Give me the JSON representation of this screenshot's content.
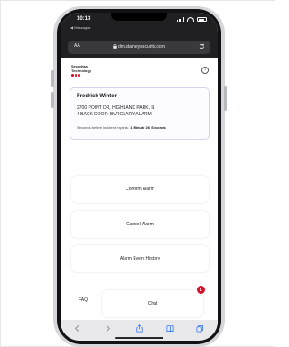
{
  "status_bar": {
    "time": "10:13",
    "back_app": "◀ Messages"
  },
  "browser": {
    "aa_label": "AA",
    "url": "dm.stanleysecurity.com"
  },
  "header": {
    "brand_line1": "Securitas",
    "brand_line2": "Technology",
    "help_label": "?"
  },
  "alarm": {
    "name": "Fredrick Winter",
    "address": "2700 POINT DR, HIGHLAND PARK, IL",
    "zone": "4 BACK DOOR: BURGLARY ALARM",
    "countdown_label": "Seconds before incident expires:",
    "countdown_value": "1 Minute 26 Seconds"
  },
  "actions": {
    "confirm": "Confirm Alarm",
    "cancel": "Cancel Alarm",
    "history": "Alarm Event History"
  },
  "chat": {
    "faq": "FAQ",
    "chat": "Chat",
    "badge": "1"
  },
  "colors": {
    "brand_red": "#d3132b",
    "card_border": "#d9d2ee",
    "browser_dark": "#202022",
    "toolbar_blue": "#3478f6"
  },
  "icons": [
    "lock-icon",
    "reload-icon",
    "help-icon",
    "back-arrow-icon",
    "forward-arrow-icon",
    "share-icon",
    "bookmarks-icon",
    "tabs-icon"
  ]
}
